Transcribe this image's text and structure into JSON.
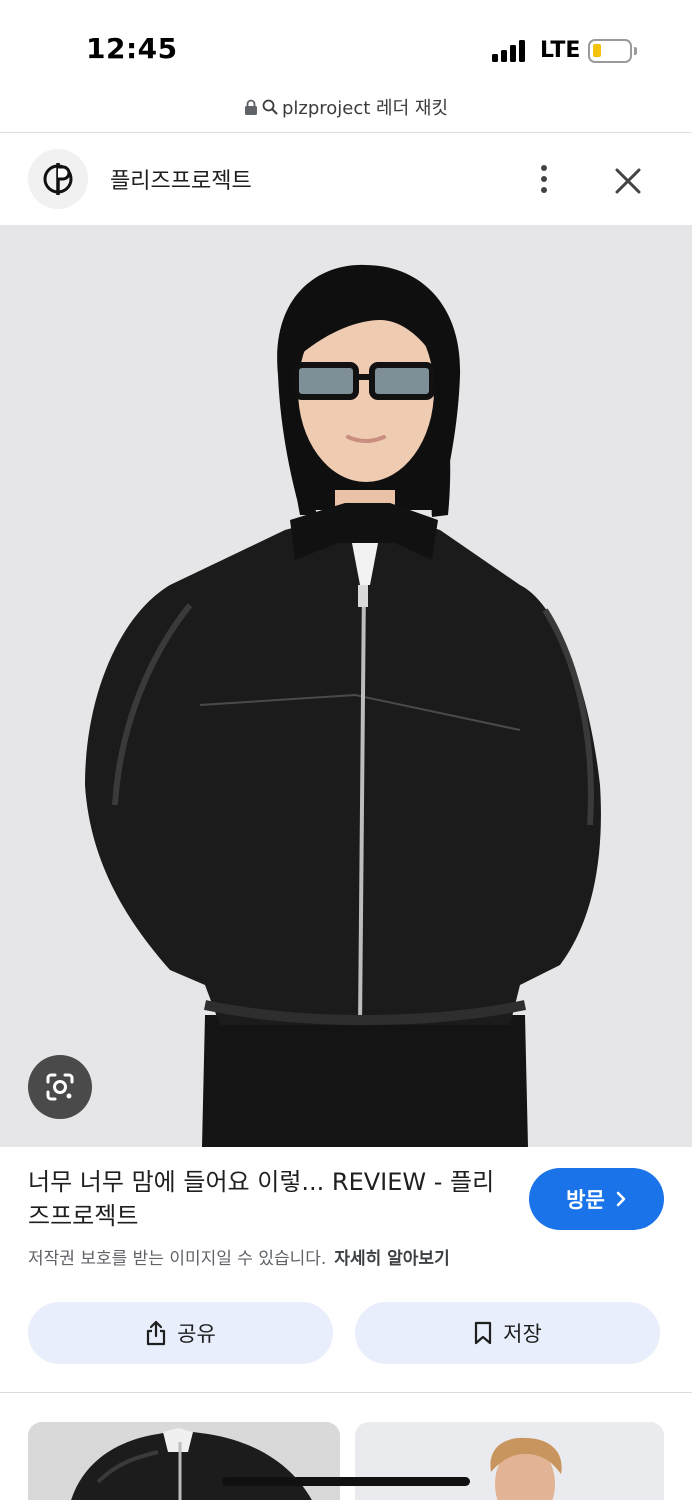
{
  "status_bar": {
    "time": "12:45",
    "network": "LTE",
    "battery_color": "#f4c20d"
  },
  "url_bar": {
    "lock_icon": "lock-icon",
    "search_icon": "search-icon",
    "text": "plzproject 레더 재킷"
  },
  "site_header": {
    "logo_icon": "plzproject-logo",
    "site_name": "플리즈프로젝트",
    "more_icon": "more-vert-icon",
    "close_icon": "close-icon"
  },
  "main_image": {
    "subject": "model-wearing-black-leather-jacket",
    "lens_icon": "google-lens-icon"
  },
  "result": {
    "title": "너무 너무 맘에 들어요 이렇... REVIEW - 플리즈프로젝트",
    "visit_label": "방문",
    "visit_icon": "chevron-right-icon",
    "copyright_text": "저작권 보호를 받는 이미지일 수 있습니다.",
    "learn_more_label": "자세히 알아보기"
  },
  "actions": {
    "share_label": "공유",
    "share_icon": "share-icon",
    "save_label": "저장",
    "save_icon": "bookmark-icon"
  },
  "colors": {
    "accent": "#1a73e8",
    "action_bg": "#e8eefb"
  }
}
